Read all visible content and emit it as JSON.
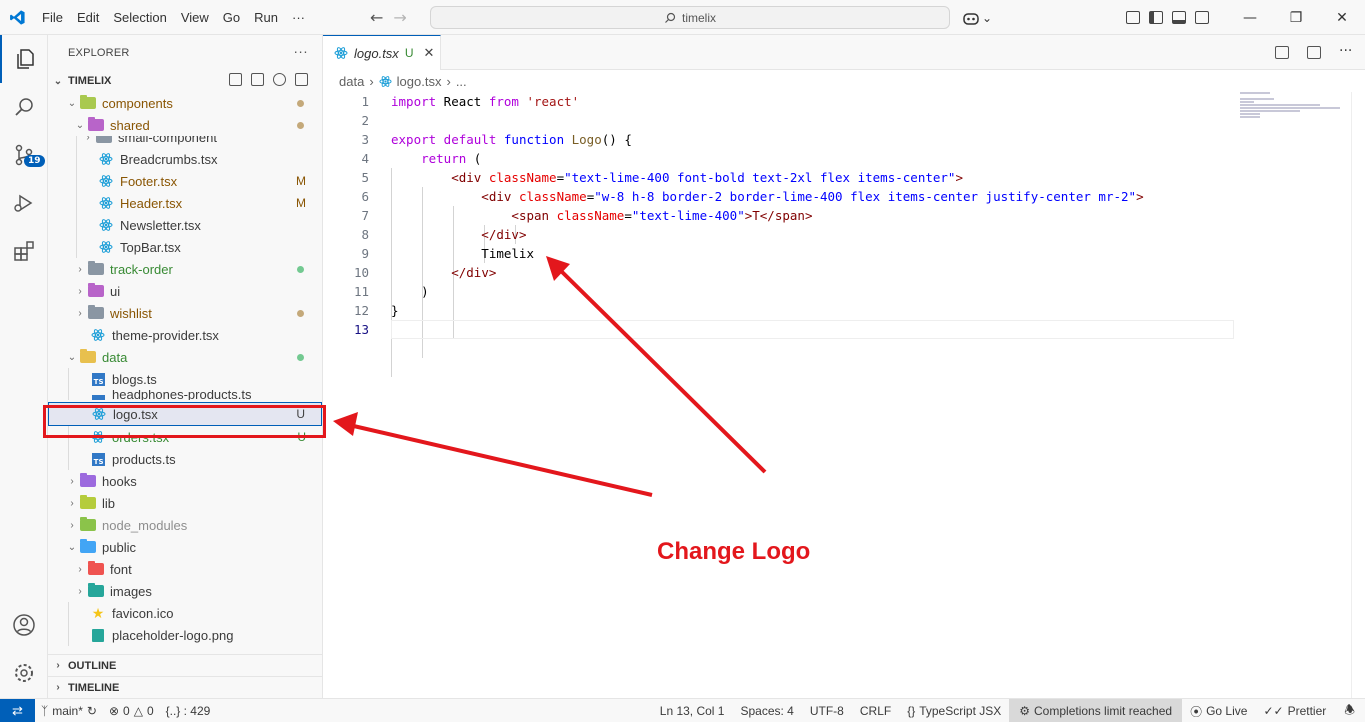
{
  "menu": [
    "File",
    "Edit",
    "Selection",
    "View",
    "Go",
    "Run",
    "···"
  ],
  "command_center": "timelix",
  "explorer": {
    "header": "EXPLORER",
    "root": "TIMELIX",
    "tree": [
      {
        "label": "components",
        "status": "dot",
        "status_color": "#c4a97a"
      },
      {
        "label": "shared",
        "status": "dot",
        "status_color": "#c4a97a"
      },
      {
        "label": "small-component",
        "status": ""
      },
      {
        "label": "Breadcrumbs.tsx",
        "status": ""
      },
      {
        "label": "Footer.tsx",
        "status": "M"
      },
      {
        "label": "Header.tsx",
        "status": "M"
      },
      {
        "label": "Newsletter.tsx",
        "status": ""
      },
      {
        "label": "TopBar.tsx",
        "status": ""
      },
      {
        "label": "track-order",
        "status": "dot",
        "status_color": "#73c991"
      },
      {
        "label": "ui",
        "status": ""
      },
      {
        "label": "wishlist",
        "status": "dot",
        "status_color": "#c4a97a"
      },
      {
        "label": "theme-provider.tsx",
        "status": ""
      },
      {
        "label": "data",
        "status": "dot",
        "status_color": "#73c991"
      },
      {
        "label": "blogs.ts",
        "status": ""
      },
      {
        "label": "headphones-products.ts",
        "status": ""
      },
      {
        "label": "logo.tsx",
        "status": "U"
      },
      {
        "label": "orders.tsx",
        "status": "U"
      },
      {
        "label": "products.ts",
        "status": ""
      },
      {
        "label": "hooks",
        "status": ""
      },
      {
        "label": "lib",
        "status": ""
      },
      {
        "label": "node_modules",
        "status": ""
      },
      {
        "label": "public",
        "status": ""
      },
      {
        "label": "font",
        "status": ""
      },
      {
        "label": "images",
        "status": ""
      },
      {
        "label": "favicon.ico",
        "status": ""
      },
      {
        "label": "placeholder-logo.png",
        "status": ""
      }
    ],
    "outline": "OUTLINE",
    "timeline": "TIMELINE"
  },
  "activity": {
    "scm_badge": "19"
  },
  "tab": {
    "label": "logo.tsx",
    "status": "U",
    "close": "✕"
  },
  "breadcrumb": {
    "folder": "data",
    "file": "logo.tsx",
    "more": "..."
  },
  "line_numbers": [
    "1",
    "2",
    "3",
    "4",
    "5",
    "6",
    "7",
    "8",
    "9",
    "10",
    "11",
    "12",
    "13"
  ],
  "code": {
    "l1_kw": "import",
    "l1_name": " React ",
    "l1_from": "from",
    "l1_str": " 'react'",
    "l3_export": "export",
    "l3_default": " default",
    "l3_function": " function",
    "l3_fn": " Logo",
    "l3_rest": "() {",
    "l4_return": "    return",
    "l4_rest": " (",
    "l5_open": "        <",
    "l5_tag": "div",
    "l5_attr": " className",
    "l5_eq": "=",
    "l5_val": "\"text-lime-400 font-bold text-2xl flex items-center\"",
    "l5_close": ">",
    "l6_open": "            <",
    "l6_tag": "div",
    "l6_attr": " className",
    "l6_eq": "=",
    "l6_val": "\"w-8 h-8 border-2 border-lime-400 flex items-center justify-center mr-2\"",
    "l6_close": ">",
    "l7_open": "                <",
    "l7_tag": "span",
    "l7_attr": " className",
    "l7_eq": "=",
    "l7_val": "\"text-lime-400\"",
    "l7_text": ">T</",
    "l7_tag2": "span",
    "l7_close": ">",
    "l8_open": "            </",
    "l8_tag": "div",
    "l8_close": ">",
    "l9_text": "            Timelix",
    "l10_open": "        </",
    "l10_tag": "div",
    "l10_close": ">",
    "l11": "    )",
    "l12": "}"
  },
  "annotation": {
    "callout": "Change Logo"
  },
  "status": {
    "branch": "main*",
    "errors": "0",
    "warnings": "0",
    "symbols": "{..} : 429",
    "position": "Ln 13, Col 1",
    "spaces": "Spaces: 4",
    "encoding": "UTF-8",
    "eol": "CRLF",
    "language": "TypeScript JSX",
    "completions": "Completions limit reached",
    "golive": "Go Live",
    "prettier": "Prettier"
  }
}
